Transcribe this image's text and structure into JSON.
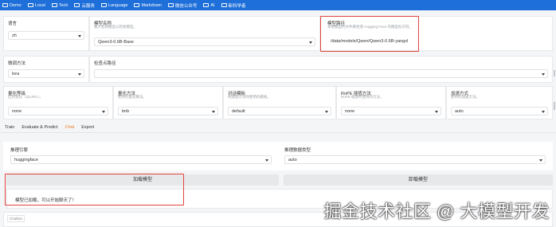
{
  "bookmarks": [
    "Demo",
    "Local",
    "Tech",
    "云服务",
    "Language",
    "Markdown",
    "微信公众号",
    "AI",
    "新科学者"
  ],
  "config": {
    "row1": {
      "lang": {
        "label": "语言",
        "value": "zh"
      },
      "model_name": {
        "label": "模型名称",
        "hint": "输入初始模型以检索模型。",
        "value": "Qwen3-0.6B-Base"
      },
      "model_path": {
        "label": "模型路径",
        "hint": "本地模型的文件路径或 Hugging Face 的模型标识符。",
        "value": "/data/models/Qwen/Qwen3-0.6B-yangxl"
      }
    },
    "row2": {
      "finetune": {
        "label": "微调方法",
        "value": "lora"
      },
      "checkpoint": {
        "label": "检查点路径",
        "value": ""
      }
    },
    "row3": {
      "quant_bit": {
        "label": "量化等级",
        "hint": "启用量化（QLoRA）。",
        "value": "none"
      },
      "quant_method": {
        "label": "量化方法",
        "hint": "使用的量化算法。",
        "value": "bnb"
      },
      "template": {
        "label": "对话模板",
        "hint": "构建提示词时使用的模板。",
        "value": "default"
      },
      "rope": {
        "label": "RoPE 插值方法",
        "hint": "RoPE 缩放时使用的方法。",
        "value": "none"
      },
      "booster": {
        "label": "加速方式",
        "hint": "使用的加速方法。",
        "value": "auto"
      }
    }
  },
  "tabs": [
    "Train",
    "Evaluate & Predict",
    "Chat",
    "Export"
  ],
  "active_tab": "Chat",
  "chat": {
    "infer_backend": {
      "label": "推理引擎",
      "value": "huggingface"
    },
    "infer_dtype": {
      "label": "推理数据类型",
      "value": "auto"
    },
    "load_button": "加载模型",
    "unload_button": "卸载模型",
    "info_text": "模型已加载，可以开始聊天了！",
    "chatbot_label": "Chatbot"
  },
  "watermark": "掘金技术社区 @ 大模型开发",
  "accent_color": "#f07b22",
  "highlight_color": "#e0443d"
}
